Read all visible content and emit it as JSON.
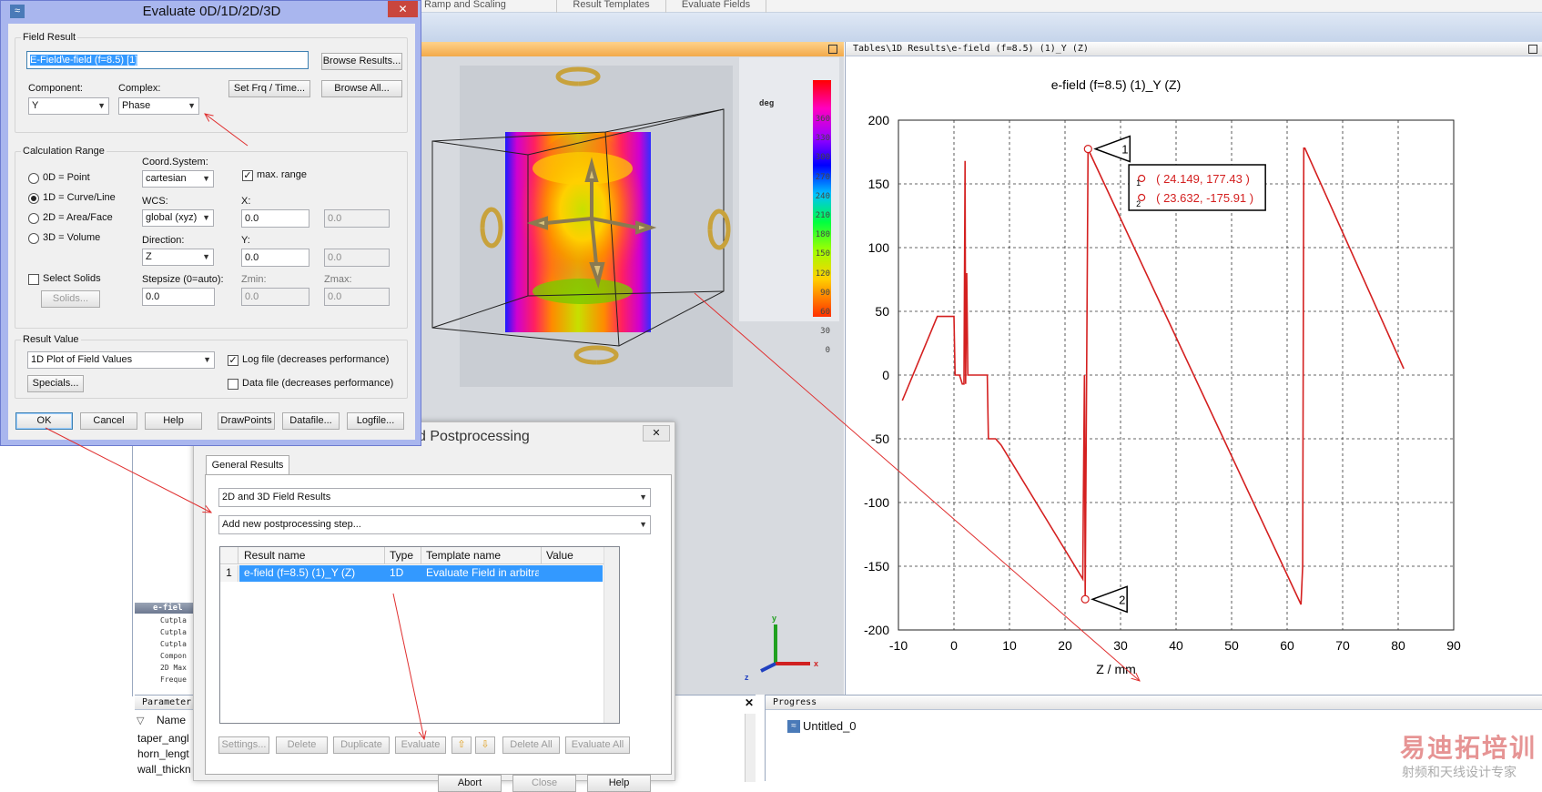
{
  "ribbon": {
    "tabs": [
      "Ramp and Scaling",
      "Result Templates",
      "Evaluate Fields"
    ]
  },
  "view3d": {
    "legend": {
      "unit": "deg",
      "ticks": [
        "360",
        "330",
        "300",
        "270",
        "240",
        "210",
        "180",
        "150",
        "120",
        "90",
        "60",
        "30",
        "0"
      ]
    },
    "axes": {
      "y": "y",
      "x": "x",
      "z": "z"
    }
  },
  "plot_panel": {
    "title": "Tables\\1D Results\\e-field (f=8.5) (1)_Y (Z)"
  },
  "chart_data": {
    "type": "line",
    "title": "e-field (f=8.5) (1)_Y (Z)",
    "xlabel": "Z / mm",
    "ylabel": "",
    "xlim": [
      -10,
      90
    ],
    "ylim": [
      -200,
      200
    ],
    "xticks": [
      "-10",
      "0",
      "10",
      "20",
      "30",
      "40",
      "50",
      "60",
      "70",
      "80",
      "90"
    ],
    "yticks": [
      "200",
      "150",
      "100",
      "50",
      "0",
      "-50",
      "-100",
      "-150",
      "-200"
    ],
    "grid": true,
    "series": [
      {
        "color": "#d42020",
        "x": [
          -9.3,
          -3,
          -1,
          0,
          0.2,
          1,
          1.5,
          1.8,
          2,
          2.1,
          2.3,
          2.5,
          2.7,
          6,
          6.2,
          7.5,
          8.5,
          23.2,
          23.3,
          23.5,
          23.632,
          24.149,
          24.4,
          62.5,
          62.8,
          63,
          63.2,
          81
        ]
      }
    ],
    "series_y": [
      -20,
      46,
      46,
      46,
      0,
      0,
      -7,
      -7,
      168,
      -7,
      80,
      0,
      0,
      0,
      -50,
      -50,
      -55,
      -160,
      -100,
      0,
      -175.91,
      177.43,
      175,
      -180,
      -150,
      178,
      178,
      5
    ],
    "markers": [
      {
        "label": "1",
        "x": 24.149,
        "y": 177.43
      },
      {
        "label": "2",
        "x": 23.632,
        "y": -175.91
      }
    ],
    "readout": [
      "( 24.149, 177.43 )",
      "( 23.632, -175.91 )"
    ]
  },
  "tree_stub": {
    "title": "e-fiel",
    "lines": [
      "Cutpla",
      "Cutpla",
      "Cutpla",
      "Compon",
      "2D Max",
      "Freque"
    ]
  },
  "param_panel": {
    "title": "Parameter",
    "header": "Name",
    "rows": [
      "taper_angl",
      "horn_lengt",
      "wall_thickn"
    ]
  },
  "progress_panel": {
    "title": "Progress",
    "item": "Untitled_0"
  },
  "eval_dialog": {
    "title": "Evaluate 0D/1D/2D/3D",
    "field_result": {
      "group": "Field Result",
      "value": "E-Field\\e-field (f=8.5) [1]",
      "browse_results": "Browse Results...",
      "component_label": "Component:",
      "component": "Y",
      "complex_label": "Complex:",
      "complex": "Phase",
      "set_frq": "Set Frq / Time...",
      "browse_all": "Browse All..."
    },
    "calc_range": {
      "group": "Calculation Range",
      "options": [
        "0D = Point",
        "1D = Curve/Line",
        "2D = Area/Face",
        "3D = Volume"
      ],
      "selected": "1D = Curve/Line",
      "select_solids": "Select Solids",
      "solids": "Solids...",
      "coord_label": "Coord.System:",
      "coord": "cartesian",
      "max_range": "max. range",
      "wcs_label": "WCS:",
      "wcs": "global (xyz)",
      "direction_label": "Direction:",
      "direction": "Z",
      "stepsize_label": "Stepsize (0=auto):",
      "stepsize": "0.0",
      "x_label": "X:",
      "x": "0.0",
      "x2": "0.0",
      "y_label": "Y:",
      "y": "0.0",
      "y2": "0.0",
      "zmin_label": "Zmin:",
      "zmin": "0.0",
      "zmax_label": "Zmax:",
      "zmax": "0.0"
    },
    "result_value": {
      "group": "Result Value",
      "value": "1D Plot of Field Values",
      "specials": "Specials...",
      "log_file": "Log file (decreases performance)",
      "data_file": "Data file (decreases performance)"
    },
    "buttons": {
      "ok": "OK",
      "cancel": "Cancel",
      "help": "Help",
      "drawpoints": "DrawPoints",
      "datafile": "Datafile...",
      "logfile": "Logfile..."
    }
  },
  "post_dialog": {
    "title_fragment": "d Postprocessing",
    "tab": "General Results",
    "combo1": "2D and 3D Field Results",
    "combo2": "Add new postprocessing step...",
    "columns": [
      "Result name",
      "Type",
      "Template name",
      "Value"
    ],
    "rows": [
      {
        "idx": "1",
        "name": "e-field (f=8.5) (1)_Y (Z)",
        "type": "1D",
        "template": "Evaluate Field in arbitrary C",
        "value": ""
      }
    ],
    "buttons": [
      "Settings...",
      "Delete",
      "Duplicate",
      "Evaluate",
      "Delete All",
      "Evaluate All"
    ],
    "footer": [
      "Abort",
      "Close",
      "Help"
    ]
  },
  "watermark": {
    "line1": "易迪拓培训",
    "line2": "射频和天线设计专家"
  }
}
